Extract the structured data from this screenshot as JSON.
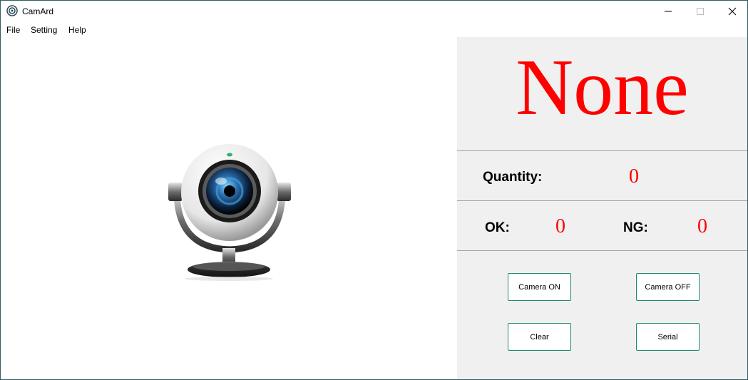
{
  "window": {
    "title": "CamArd",
    "controls": {
      "minimize": "—",
      "maximize": "□",
      "close": "✕"
    }
  },
  "menu": [
    "File",
    "Setting",
    "Help"
  ],
  "status": {
    "text": "None",
    "color": "#ff0000"
  },
  "counts": {
    "quantity_label": "Quantity:",
    "quantity_value": "0",
    "ok_label": "OK:",
    "ok_value": "0",
    "ng_label": "NG:",
    "ng_value": "0"
  },
  "buttons": {
    "camera_on": "Camera ON",
    "camera_off": "Camera OFF",
    "clear": "Clear",
    "serial": "Serial"
  },
  "icons": {
    "app": "camera-lens-icon",
    "camera_placeholder": "webcam-icon"
  },
  "colors": {
    "accent_border": "#1b8a72",
    "panel_bg": "#f0f0f0"
  }
}
